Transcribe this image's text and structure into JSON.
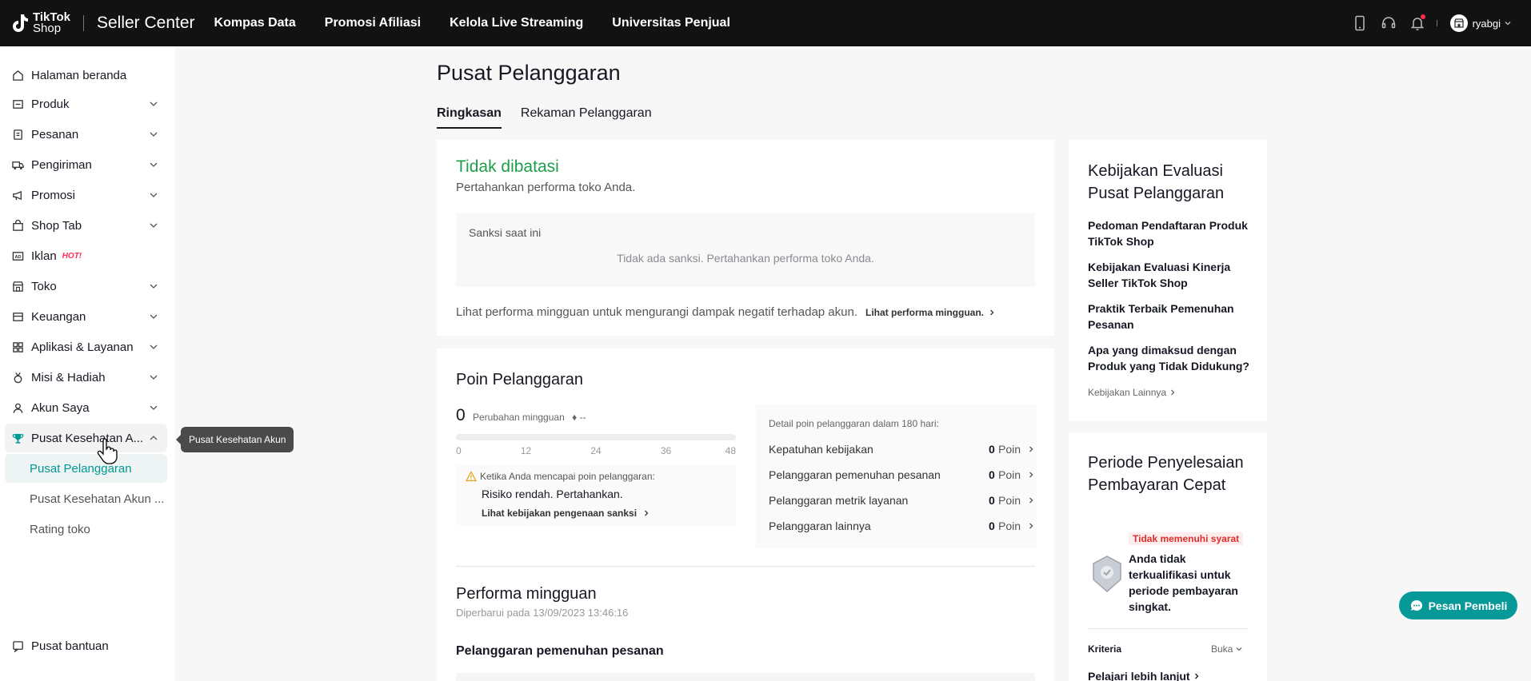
{
  "header": {
    "logo_line1": "TikTok",
    "logo_line2": "Shop",
    "brand": "Seller Center",
    "nav": [
      "Kompas Data",
      "Promosi Afiliasi",
      "Kelola Live Streaming",
      "Universitas Penjual"
    ],
    "username": "ryabgi",
    "icons": [
      "phone-icon",
      "headset-icon",
      "bell-icon",
      "store-icon"
    ]
  },
  "sidebar": {
    "items": [
      {
        "label": "Halaman beranda",
        "icon": "home-icon"
      },
      {
        "label": "Produk",
        "icon": "product-icon"
      },
      {
        "label": "Pesanan",
        "icon": "order-icon"
      },
      {
        "label": "Pengiriman",
        "icon": "truck-icon"
      },
      {
        "label": "Promosi",
        "icon": "megaphone-icon"
      },
      {
        "label": "Shop Tab",
        "icon": "shop-bag-icon"
      },
      {
        "label": "Iklan",
        "icon": "ad-icon",
        "badge": "HOT!"
      },
      {
        "label": "Toko",
        "icon": "store-icon"
      },
      {
        "label": "Keuangan",
        "icon": "wallet-icon"
      },
      {
        "label": "Aplikasi & Layanan",
        "icon": "apps-icon"
      },
      {
        "label": "Misi & Hadiah",
        "icon": "medal-icon"
      },
      {
        "label": "Akun Saya",
        "icon": "user-icon"
      },
      {
        "label": "Pusat Kesehatan A...",
        "icon": "trophy-icon"
      }
    ],
    "sub_items": [
      "Pusat Pelanggaran",
      "Pusat Kesehatan Akun ...",
      "Rating toko"
    ],
    "help": "Pusat bantuan",
    "tooltip": "Pusat Kesehatan Akun"
  },
  "main": {
    "title": "Pusat Pelanggaran",
    "tabs": [
      "Ringkasan",
      "Rekaman Pelanggaran"
    ],
    "status": {
      "title": "Tidak dibatasi",
      "subtitle": "Pertahankan performa toko Anda.",
      "sanction_label": "Sanksi saat ini",
      "sanction_empty": "Tidak ada sanksi. Pertahankan performa toko Anda.",
      "weekly_text": "Lihat performa mingguan untuk mengurangi dampak negatif terhadap akun.",
      "weekly_link": "Lihat performa mingguan."
    },
    "points": {
      "title": "Poin Pelanggaran",
      "value": "0",
      "change_label": "Perubahan mingguan",
      "change_value": "♦ --",
      "ticks": [
        "0",
        "12",
        "24",
        "36",
        "48"
      ],
      "tick_max": 48,
      "risk_head": "Ketika Anda mencapai  poin pelanggaran:",
      "risk_text": "Risiko rendah. Pertahankan.",
      "risk_link": "Lihat kebijakan pengenaan sanksi",
      "detail_head": "Detail poin pelanggaran dalam 180 hari:",
      "detail_rows": [
        {
          "label": "Kepatuhan kebijakan",
          "value": "0",
          "unit": "Poin"
        },
        {
          "label": "Pelanggaran pemenuhan pesanan",
          "value": "0",
          "unit": "Poin"
        },
        {
          "label": "Pelanggaran metrik layanan",
          "value": "0",
          "unit": "Poin"
        },
        {
          "label": "Pelanggaran lainnya",
          "value": "0",
          "unit": "Poin"
        }
      ]
    },
    "weekly": {
      "title": "Performa mingguan",
      "updated": "Diperbarui pada 13/09/2023 13:46:16",
      "subheading": "Pelanggaran pemenuhan pesanan"
    }
  },
  "right": {
    "policy_title": "Kebijakan Evaluasi Pusat Pelanggaran",
    "policy_links": [
      "Pedoman Pendaftaran Produk TikTok Shop",
      "Kebijakan Evaluasi Kinerja Seller TikTok Shop",
      "Praktik Terbaik Pemenuhan Pesanan",
      "Apa yang dimaksud dengan Produk yang Tidak Didukung?"
    ],
    "policy_more": "Kebijakan Lainnya",
    "fast_title": "Periode Penyelesaian Pembayaran Cepat",
    "fast_badge": "Tidak memenuhi syarat",
    "fast_desc": "Anda tidak terkualifikasi untuk periode pembayaran singkat.",
    "criteria": "Kriteria",
    "open": "Buka",
    "learn_more": "Pelajari lebih lanjut"
  },
  "chat": {
    "label": "Pesan Pembeli"
  },
  "colors": {
    "topbar": "#121212",
    "accent": "#009995",
    "ok": "#1e9e4a",
    "danger": "#e22c2c"
  }
}
